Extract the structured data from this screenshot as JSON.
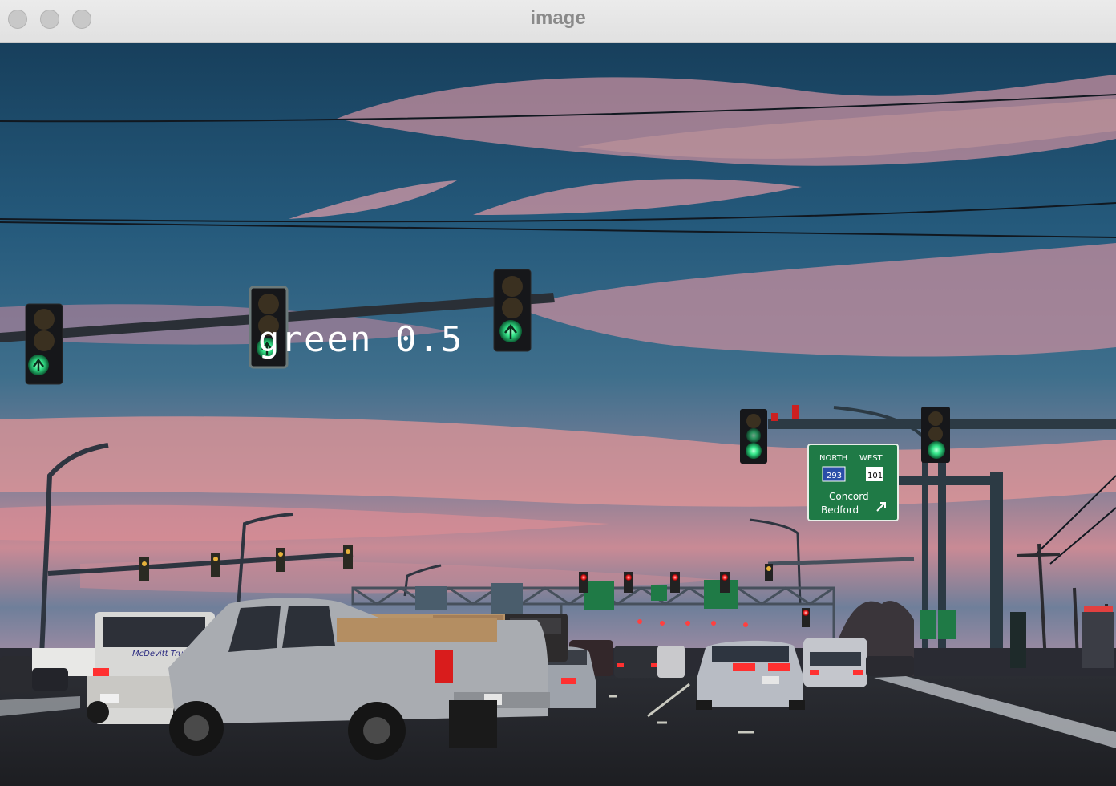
{
  "window": {
    "title": "image"
  },
  "detection": {
    "label": "green 0.5"
  },
  "road_sign": {
    "line1_left": "NORTH",
    "line1_right": "WEST",
    "route_a": "293",
    "route_b": "101",
    "line2": "Concord",
    "line3": "Bedford"
  },
  "truck_text": {
    "door_text": "McDevitt Trucks"
  },
  "colors": {
    "sky_top": "#1d4a66",
    "sky_pink": "#e79a9c",
    "signal_green": "#35e68a",
    "sign_green": "#1f7a46",
    "brake_red": "#ff3030"
  }
}
